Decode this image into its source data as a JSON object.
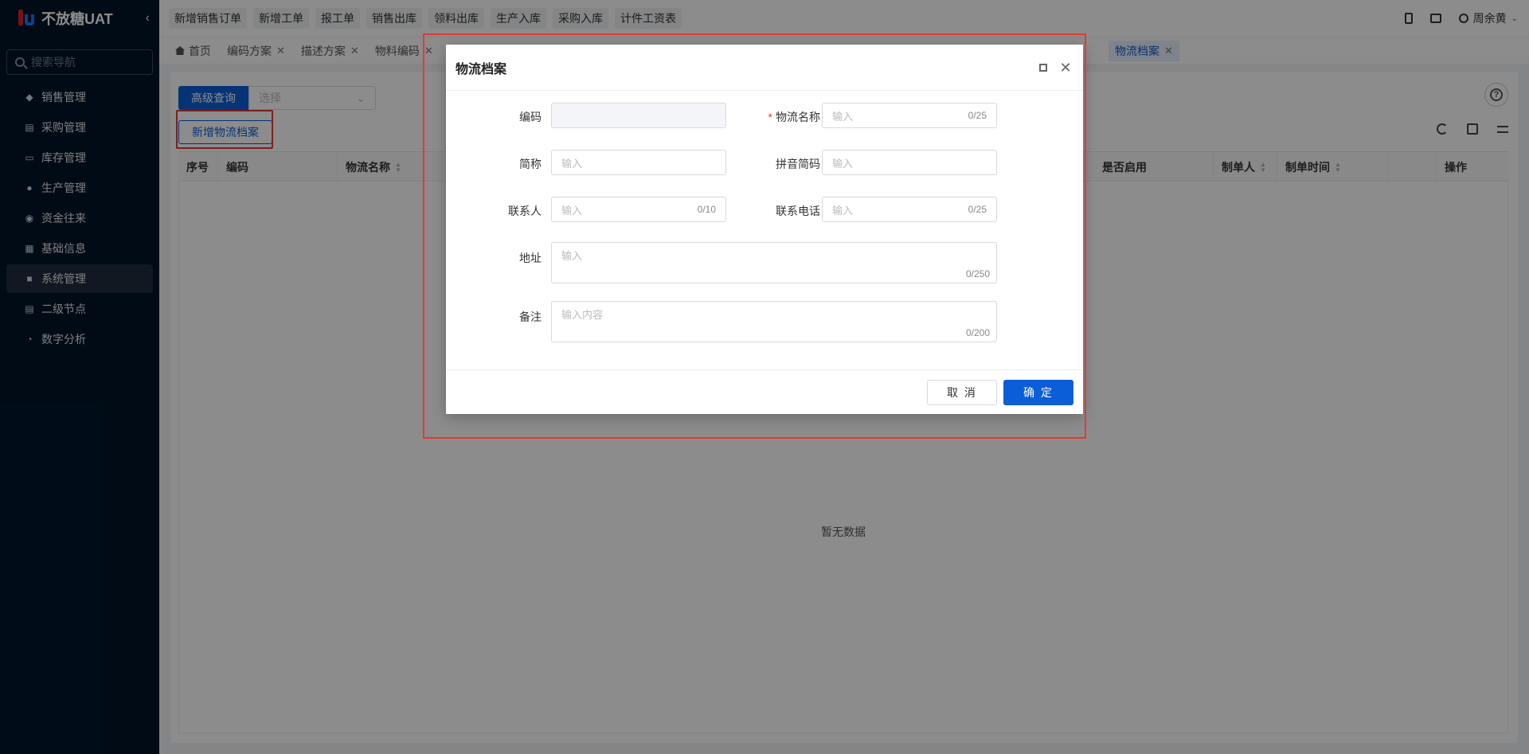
{
  "app": {
    "title": "不放糖UAT"
  },
  "sidebar": {
    "search_placeholder": "搜索导航",
    "items": [
      {
        "label": "销售管理",
        "icon": "tag-icon"
      },
      {
        "label": "采购管理",
        "icon": "cart-icon"
      },
      {
        "label": "库存管理",
        "icon": "box-icon"
      },
      {
        "label": "生产管理",
        "icon": "production-icon"
      },
      {
        "label": "资金往来",
        "icon": "money-icon"
      },
      {
        "label": "基础信息",
        "icon": "grid-icon"
      },
      {
        "label": "系统管理",
        "icon": "apps-icon",
        "active": true
      },
      {
        "label": "二级节点",
        "icon": "doc-icon"
      },
      {
        "label": "数字分析",
        "icon": "pie-icon"
      }
    ]
  },
  "topbar": {
    "quick_buttons": [
      "新增销售订单",
      "新增工单",
      "报工单",
      "销售出库",
      "领料出库",
      "生产入库",
      "采购入库",
      "计件工资表"
    ],
    "user_name": "周余黄"
  },
  "tabs": [
    {
      "label": "首页",
      "closable": false
    },
    {
      "label": "编码方案",
      "closable": true
    },
    {
      "label": "描述方案",
      "closable": true
    },
    {
      "label": "物料编码",
      "closable": true
    },
    {
      "label": "物流档案",
      "closable": true,
      "active": true
    }
  ],
  "content": {
    "advanced_query_label": "高级查询",
    "select_placeholder": "选择",
    "add_button_label": "新增物流档案",
    "columns": [
      "序号",
      "编码",
      "物流名称",
      "是否启用",
      "制单人",
      "制单时间",
      "操作"
    ],
    "empty_text": "暂无数据"
  },
  "dialog": {
    "title": "物流档案",
    "fields": {
      "code": {
        "label": "编码",
        "value": ""
      },
      "name": {
        "label": "物流名称",
        "placeholder": "输入",
        "count": "0/25",
        "required": true
      },
      "short_name": {
        "label": "简称",
        "placeholder": "输入"
      },
      "pinyin": {
        "label": "拼音简码",
        "placeholder": "输入"
      },
      "contact": {
        "label": "联系人",
        "placeholder": "输入",
        "count": "0/10"
      },
      "phone": {
        "label": "联系电话",
        "placeholder": "输入",
        "count": "0/25"
      },
      "address": {
        "label": "地址",
        "placeholder": "输入",
        "count": "0/250"
      },
      "remark": {
        "label": "备注",
        "placeholder": "输入内容",
        "count": "0/200"
      }
    },
    "cancel_label": "取 消",
    "ok_label": "确 定"
  },
  "colors": {
    "primary": "#0b5ed7",
    "sidebar_bg": "#001529",
    "highlight": "#e53935"
  }
}
